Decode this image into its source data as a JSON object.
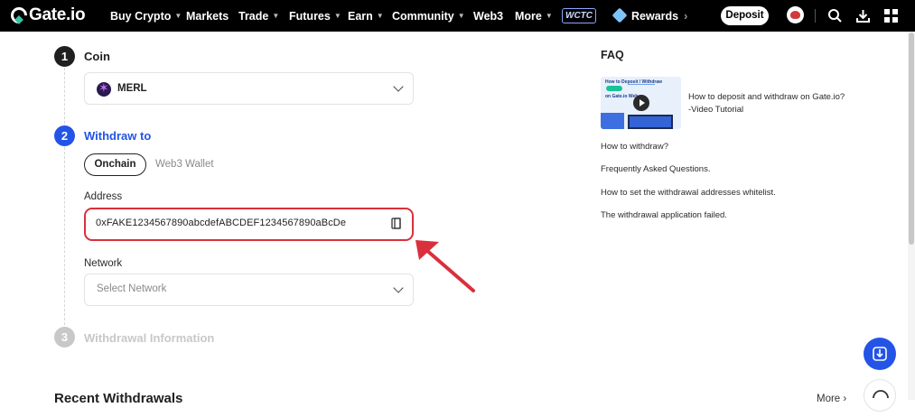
{
  "brand": {
    "name": "Gate.io"
  },
  "nav": {
    "items": [
      {
        "label": "Buy Crypto",
        "caret": true
      },
      {
        "label": "Markets",
        "caret": false
      },
      {
        "label": "Trade",
        "caret": true
      },
      {
        "label": "Futures",
        "caret": true
      },
      {
        "label": "Earn",
        "caret": true
      },
      {
        "label": "Community",
        "caret": true
      },
      {
        "label": "Web3",
        "caret": false
      },
      {
        "label": "More",
        "caret": true
      }
    ],
    "badge": "WCTC",
    "rewards_label": "Rewards",
    "deposit_label": "Deposit",
    "icons": [
      "search-icon",
      "download-icon",
      "grid-menu-icon"
    ]
  },
  "steps": [
    {
      "number": "1",
      "title": "Coin",
      "color": "#1f1f1f"
    },
    {
      "number": "2",
      "title": "Withdraw to",
      "color": "#2354e6"
    },
    {
      "number": "3",
      "title": "Withdrawal Information",
      "color": "#c8c8c8"
    }
  ],
  "coin": {
    "symbol": "MERL",
    "icon": "merlin-coin-icon"
  },
  "withdraw_to": {
    "tabs": [
      {
        "label": "Onchain",
        "active": true
      },
      {
        "label": "Web3 Wallet",
        "active": false
      }
    ],
    "address_label": "Address",
    "address_value": "0xFAKE1234567890abcdefABCDEF1234567890aBcDe",
    "network_label": "Network",
    "network_placeholder": "Select Network"
  },
  "faq": {
    "title": "FAQ",
    "video": {
      "thumb_title": "How to Deposit / Withdraw",
      "thumb_sub": "on Gate.io Web",
      "line1": "How to deposit and withdraw on Gate.io?",
      "line2": "-Video Tutorial"
    },
    "links": [
      "How to withdraw?",
      "Frequently Asked Questions.",
      "How to set the withdrawal addresses whitelist.",
      "The withdrawal application failed."
    ]
  },
  "recent": {
    "title": "Recent Withdrawals",
    "more_label": "More"
  },
  "colors": {
    "accent": "#2354e6",
    "highlight": "#d9303b",
    "topbar": "#000000"
  }
}
